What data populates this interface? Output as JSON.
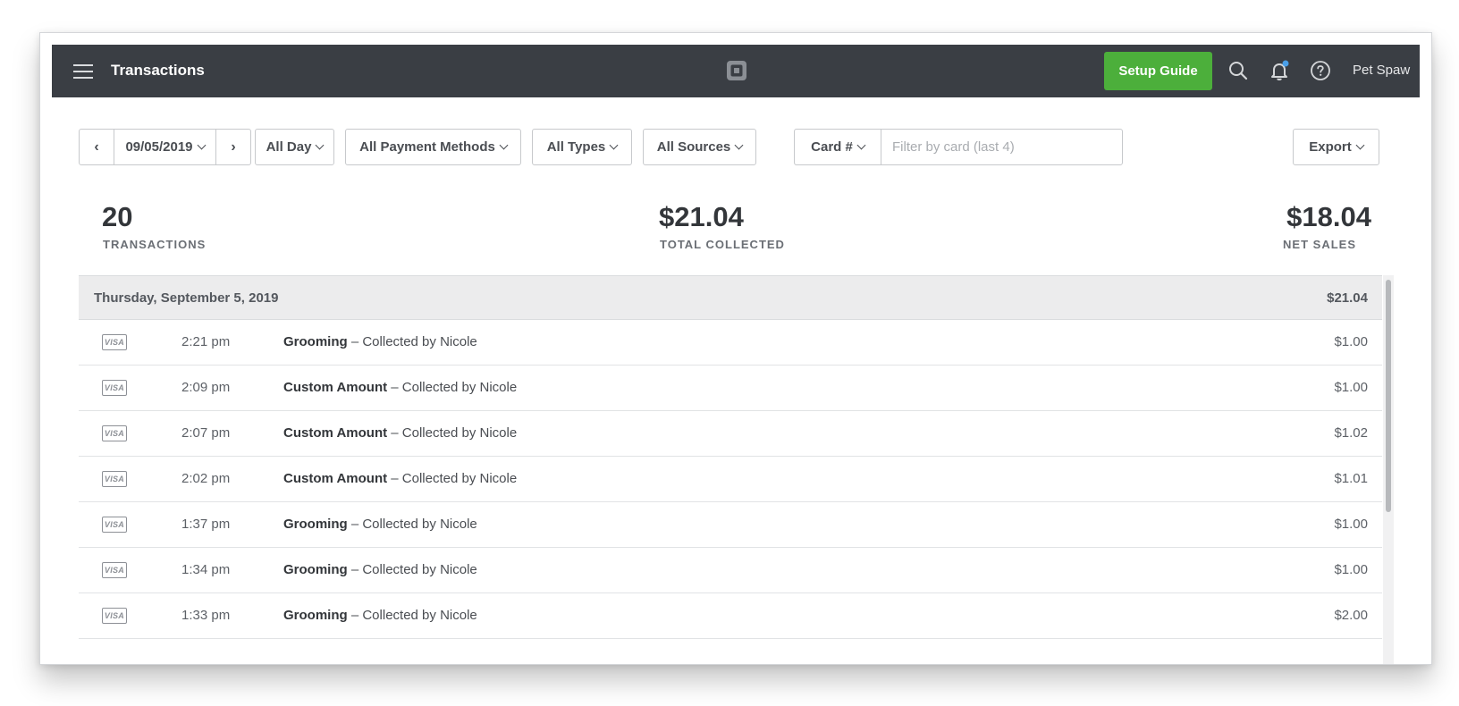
{
  "header": {
    "title": "Transactions",
    "setup_guide": "Setup Guide",
    "user_name": "Pet Spaw",
    "colors": {
      "bar": "#3a3e44",
      "accent_green": "#4caf3b",
      "notification_dot": "#4a9fe8"
    }
  },
  "filters": {
    "date": "09/05/2019",
    "time_range": "All Day",
    "payment_methods": "All Payment Methods",
    "types": "All Types",
    "sources": "All Sources",
    "card_select": "Card #",
    "card_placeholder": "Filter by card (last 4)",
    "export": "Export"
  },
  "stats": {
    "transactions_count": "20",
    "transactions_label": "TRANSACTIONS",
    "total_collected": "$21.04",
    "total_collected_label": "TOTAL COLLECTED",
    "net_sales": "$18.04",
    "net_sales_label": "NET SALES"
  },
  "day_group": {
    "label": "Thursday, September 5, 2019",
    "total": "$21.04"
  },
  "transactions": [
    {
      "card": "VISA",
      "time": "2:21 pm",
      "item": "Grooming",
      "collector": "– Collected by Nicole",
      "amount": "$1.00"
    },
    {
      "card": "VISA",
      "time": "2:09 pm",
      "item": "Custom Amount",
      "collector": "– Collected by Nicole",
      "amount": "$1.00"
    },
    {
      "card": "VISA",
      "time": "2:07 pm",
      "item": "Custom Amount",
      "collector": "– Collected by Nicole",
      "amount": "$1.02"
    },
    {
      "card": "VISA",
      "time": "2:02 pm",
      "item": "Custom Amount",
      "collector": "– Collected by Nicole",
      "amount": "$1.01"
    },
    {
      "card": "VISA",
      "time": "1:37 pm",
      "item": "Grooming",
      "collector": "– Collected by Nicole",
      "amount": "$1.00"
    },
    {
      "card": "VISA",
      "time": "1:34 pm",
      "item": "Grooming",
      "collector": "– Collected by Nicole",
      "amount": "$1.00"
    },
    {
      "card": "VISA",
      "time": "1:33 pm",
      "item": "Grooming",
      "collector": "– Collected by Nicole",
      "amount": "$2.00"
    }
  ]
}
